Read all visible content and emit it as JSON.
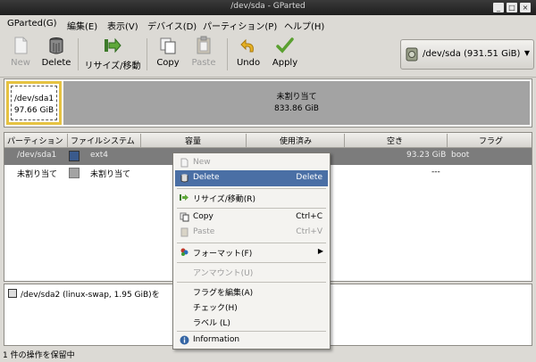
{
  "window": {
    "title": "/dev/sda - GParted"
  },
  "menubar": {
    "items": [
      "GParted(G)",
      "編集(E)",
      "表示(V)",
      "デバイス(D)",
      "パーティション(P)",
      "ヘルプ(H)"
    ]
  },
  "toolbar": {
    "new": "New",
    "delete": "Delete",
    "resize": "リサイズ/移動",
    "copy": "Copy",
    "paste": "Paste",
    "undo": "Undo",
    "apply": "Apply"
  },
  "device_selector": {
    "label": "/dev/sda  (931.51 GiB)"
  },
  "disk_map": {
    "partition1": {
      "name": "/dev/sda1",
      "size": "97.66 GiB"
    },
    "unallocated": {
      "name": "未割り当て",
      "size": "833.86 GiB"
    }
  },
  "table": {
    "headers": [
      "パーティション",
      "ファイルシステム",
      "容量",
      "使用済み",
      "空き",
      "フラグ"
    ],
    "rows": [
      {
        "partition": "/dev/sda1",
        "filesystem": "ext4",
        "size": "",
        "used": "",
        "free": "93.23 GiB",
        "flags": "boot",
        "fs_color": "#3a5a8c"
      },
      {
        "partition": "未割り当て",
        "filesystem": "未割り当て",
        "size": "",
        "used": "",
        "free": "---",
        "flags": "",
        "fs_color": "#a3a3a3"
      }
    ]
  },
  "operations": {
    "pending": "/dev/sda2 (linux-swap, 1.95 GiB)を"
  },
  "statusbar": {
    "text": "1 件の操作を保留中"
  },
  "context_menu": {
    "new": "New",
    "delete": "Delete",
    "delete_key": "Delete",
    "resize": "リサイズ/移動(R)",
    "copy": "Copy",
    "copy_key": "Ctrl+C",
    "paste": "Paste",
    "paste_key": "Ctrl+V",
    "format": "フォーマット(F)",
    "unmount": "アンマウント(U)",
    "edit_flags": "フラグを編集(A)",
    "check": "チェック(H)",
    "label": "ラベル (L)",
    "information": "Information"
  }
}
